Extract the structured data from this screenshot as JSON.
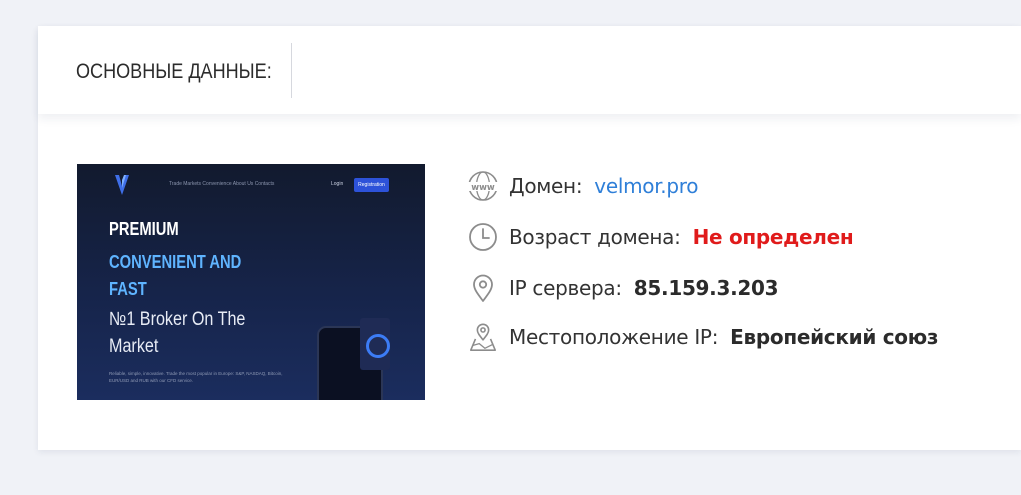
{
  "header": {
    "title": "ОСНОВНЫЕ ДАННЫЕ:"
  },
  "screenshot": {
    "menu": "Trade   Markets   Convenience   About Us   Contacts",
    "login": "Login",
    "register": "Registration",
    "headline_1": "PREMIUM",
    "headline_2": "CONVENIENT AND FAST",
    "headline_3": "№1 Broker On The Market",
    "small_text": "Reliable, simple, innovative. Trade the most popular in Europe: S&P, NASDAQ, Bitcoin, EUR/USD and RUB with our CFD service."
  },
  "info": {
    "domain": {
      "label": "Домен:",
      "value": "velmor.pro",
      "color": "#2f7fd8",
      "icon": "www-globe-icon"
    },
    "age": {
      "label": "Возраст домена:",
      "value": "Не определен",
      "color": "#e01b1b",
      "icon": "clock-icon"
    },
    "ip": {
      "label": "IP сервера:",
      "value": "85.159.3.203",
      "color": "#2b2b2b",
      "icon": "location-pin-icon"
    },
    "location": {
      "label": "Местоположение IP:",
      "value": "Европейский союз",
      "color": "#2b2b2b",
      "icon": "map-pin-icon"
    }
  }
}
